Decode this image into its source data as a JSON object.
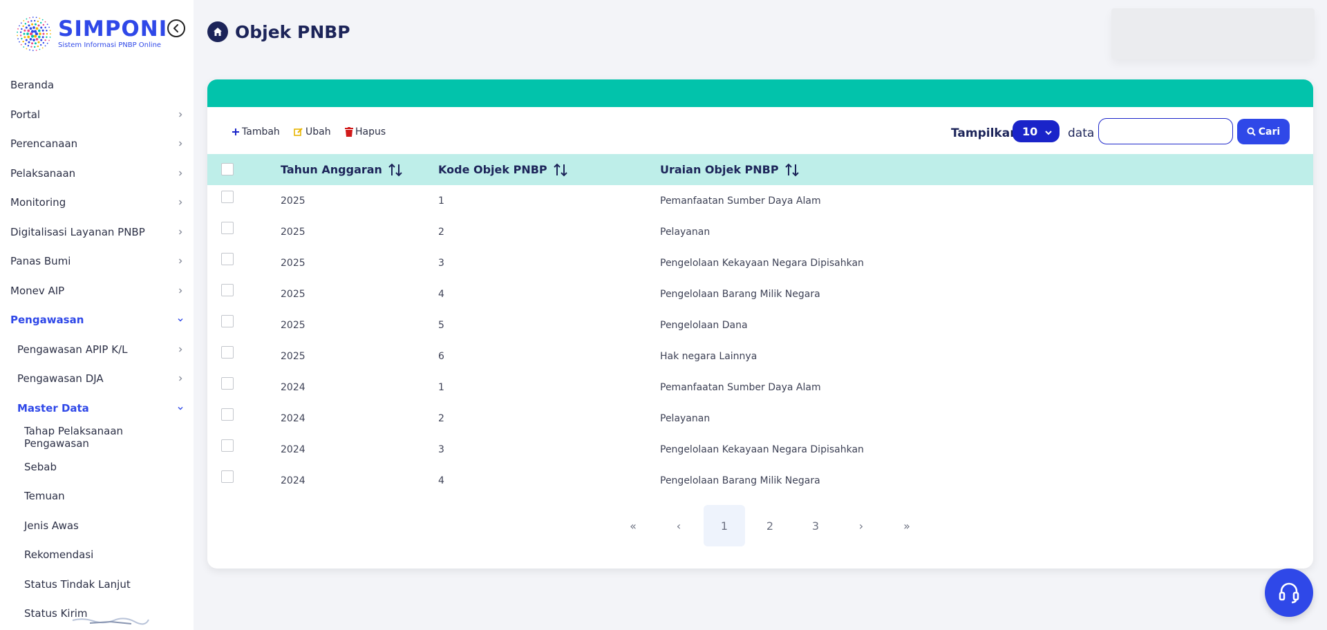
{
  "app": {
    "brand_title": "SIMPONI",
    "brand_subtitle": "Sistem Informasi PNBP Online",
    "accent_color": "#2f48e8",
    "teal_color": "#02c3ab"
  },
  "sidebar": {
    "items": [
      {
        "label": "Beranda",
        "level": 0,
        "chevron": "none"
      },
      {
        "label": "Portal",
        "level": 0,
        "chevron": "right"
      },
      {
        "label": "Perencanaan",
        "level": 0,
        "chevron": "right"
      },
      {
        "label": "Pelaksanaan",
        "level": 0,
        "chevron": "right"
      },
      {
        "label": "Monitoring",
        "level": 0,
        "chevron": "right"
      },
      {
        "label": "Digitalisasi Layanan PNBP",
        "level": 0,
        "chevron": "right"
      },
      {
        "label": "Panas Bumi",
        "level": 0,
        "chevron": "right"
      },
      {
        "label": "Monev AIP",
        "level": 0,
        "chevron": "right"
      },
      {
        "label": "Pengawasan",
        "level": 0,
        "chevron": "down",
        "active": true
      },
      {
        "label": "Pengawasan APIP K/L",
        "level": 1,
        "chevron": "right"
      },
      {
        "label": "Pengawasan DJA",
        "level": 1,
        "chevron": "right"
      },
      {
        "label": "Master Data",
        "level": 1,
        "chevron": "down",
        "active": true
      },
      {
        "label": "Tahap Pelaksanaan Pengawasan",
        "level": 2,
        "chevron": "none"
      },
      {
        "label": "Sebab",
        "level": 2,
        "chevron": "none"
      },
      {
        "label": "Temuan",
        "level": 2,
        "chevron": "none"
      },
      {
        "label": "Jenis Awas",
        "level": 2,
        "chevron": "none"
      },
      {
        "label": "Rekomendasi",
        "level": 2,
        "chevron": "none"
      },
      {
        "label": "Status Tindak Lanjut",
        "level": 2,
        "chevron": "none"
      },
      {
        "label": "Status Kirim",
        "level": 2,
        "chevron": "none"
      }
    ]
  },
  "header": {
    "title": "Objek PNBP"
  },
  "toolbar": {
    "add_label": "Tambah",
    "edit_label": "Ubah",
    "delete_label": "Hapus",
    "show_label": "Tampilkan",
    "page_size": "10",
    "data_label": "data",
    "search_value": "",
    "search_button": "Cari"
  },
  "table": {
    "columns": [
      "Tahun Anggaran",
      "Kode Objek PNBP",
      "Uraian Objek PNBP"
    ],
    "rows": [
      [
        "2025",
        "1",
        "Pemanfaatan Sumber Daya Alam"
      ],
      [
        "2025",
        "2",
        "Pelayanan"
      ],
      [
        "2025",
        "3",
        "Pengelolaan Kekayaan Negara Dipisahkan"
      ],
      [
        "2025",
        "4",
        "Pengelolaan Barang Milik Negara"
      ],
      [
        "2025",
        "5",
        "Pengelolaan Dana"
      ],
      [
        "2025",
        "6",
        "Hak negara Lainnya"
      ],
      [
        "2024",
        "1",
        "Pemanfaatan Sumber Daya Alam"
      ],
      [
        "2024",
        "2",
        "Pelayanan"
      ],
      [
        "2024",
        "3",
        "Pengelolaan Kekayaan Negara Dipisahkan"
      ],
      [
        "2024",
        "4",
        "Pengelolaan Barang Milik Negara"
      ]
    ]
  },
  "pagination": {
    "first": "«",
    "prev": "‹",
    "pages": [
      "1",
      "2",
      "3"
    ],
    "current": "1",
    "next": "›",
    "last": "»"
  }
}
